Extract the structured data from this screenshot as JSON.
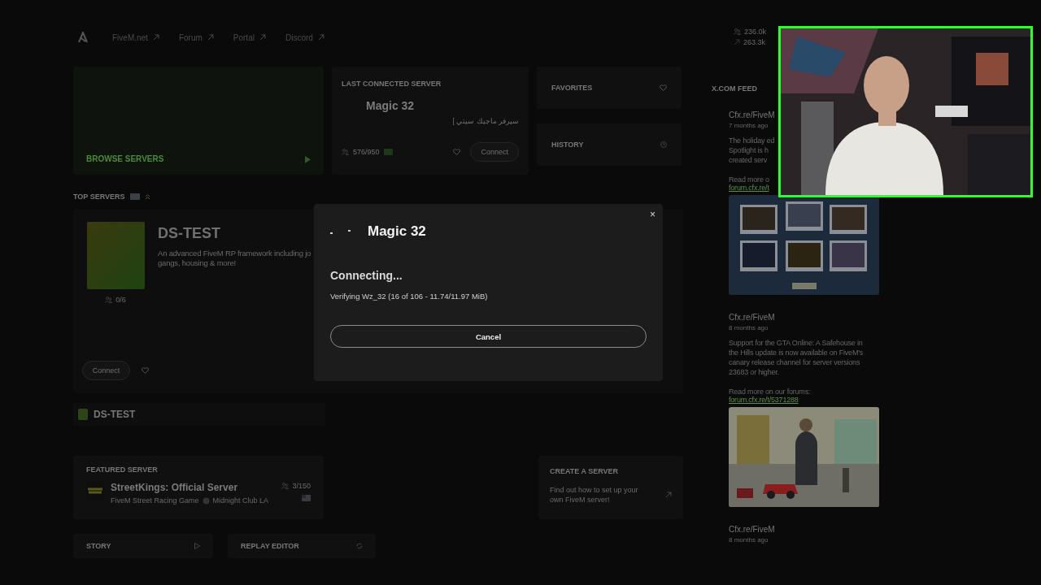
{
  "nav": {
    "links": [
      "FiveM.net",
      "Forum",
      "Portal",
      "Discord"
    ]
  },
  "stats": [
    "236.0k",
    "263.3k"
  ],
  "browse": {
    "label": "BROWSE SERVERS"
  },
  "last_connected": {
    "heading": "LAST CONNECTED SERVER",
    "name": "Magic 32",
    "description": "سيرفر ماجيك سيتي ]",
    "players": "576/950",
    "connect": "Connect"
  },
  "side_tiles": [
    "FAVORITES",
    "HISTORY"
  ],
  "top_servers": {
    "heading": "TOP SERVERS",
    "name": "DS-TEST",
    "description_lines": [
      "An advanced FiveM RP framework including jo",
      "gangs, housing & more!"
    ],
    "players": "0/6",
    "connect": "Connect"
  },
  "server_row": {
    "name": "DS-TEST"
  },
  "featured": {
    "heading": "FEATURED SERVER",
    "name": "StreetKings: Official Server",
    "description_parts": [
      "FiveM Street Racing Game",
      "Midnight Club LA"
    ],
    "players": "3/150"
  },
  "create": {
    "heading": "CREATE A SERVER",
    "text": "Find out how to set up your own FiveM server!"
  },
  "tiles": [
    "STORY",
    "REPLAY EDITOR"
  ],
  "feed": {
    "heading": "X.COM FEED",
    "posts": [
      {
        "author": "Cfx.re/FiveM",
        "time": "7 months ago",
        "lines": [
          "The holiday ed",
          "Spotlight is h",
          "created serv"
        ],
        "read_more": "Read more o",
        "link": "forum.cfx.re/t",
        "media": {
          "kind": "picture"
        }
      },
      {
        "author": "Cfx.re/FiveM",
        "time": "8 months ago",
        "lines": [
          "Support for the GTA Online: A Safehouse in",
          "the Hills update is now available on FiveM's",
          "canary release channel for server versions",
          "23683 or higher."
        ],
        "read_more": "Read more on our forums:",
        "link": "forum.cfx.re/t/5371288",
        "media": {
          "kind": "picture"
        }
      },
      {
        "author": "Cfx.re/FiveM",
        "time": "8 months ago"
      }
    ]
  },
  "webcam": {
    "kind": "picture"
  },
  "modal": {
    "close": "×",
    "server": "Magic 32",
    "status": "Connecting...",
    "detail": "Verifying Wz_32 (16 of 106 - 11.74/11.97 MiB)",
    "cancel": "Cancel"
  }
}
